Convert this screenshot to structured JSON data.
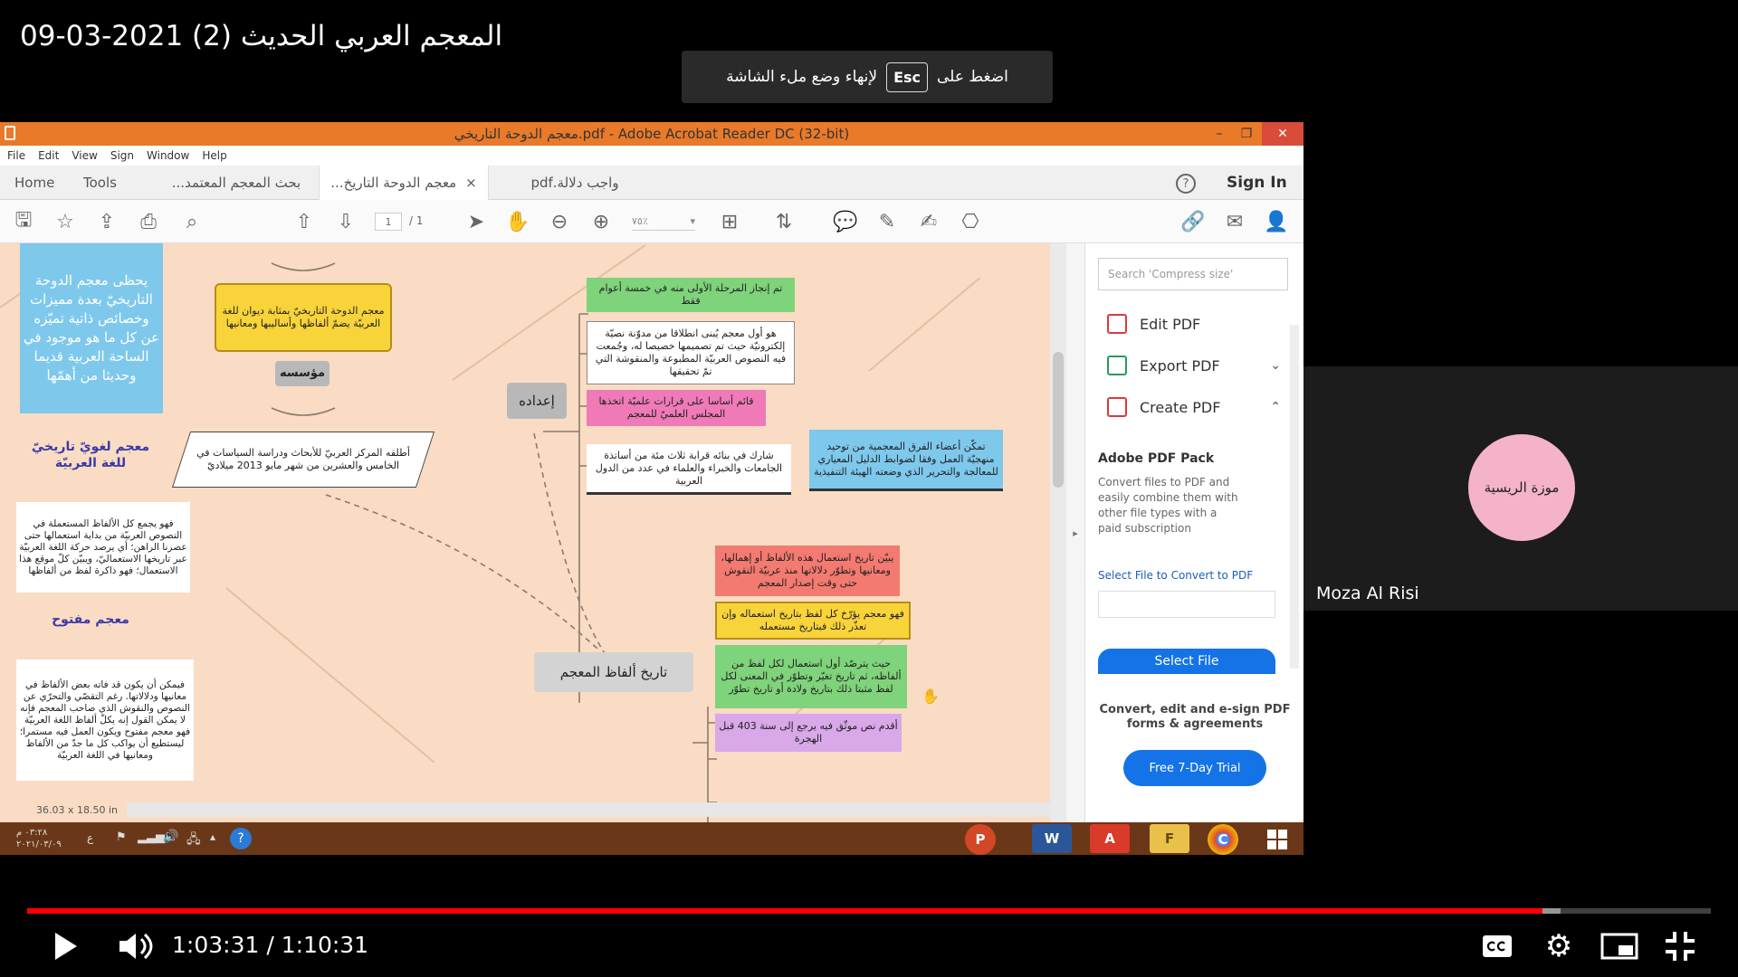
{
  "video": {
    "title": "المعجم العربي الحديث (2) 2021-03-09",
    "esc_hint_before": "اضغط على",
    "esc_key": "Esc",
    "esc_hint_after": "لإنهاء وضع ملء الشاشة",
    "current_time": "1:03:31",
    "duration": "1:10:31",
    "progress_played": 0.9,
    "progress_loaded": 0.911
  },
  "acrobat": {
    "window_title": "معجم الدوحة التاريخي.pdf - Adobe Acrobat Reader DC (32-bit)",
    "menu": [
      "File",
      "Edit",
      "View",
      "Sign",
      "Window",
      "Help"
    ],
    "tabs": {
      "home": "Home",
      "tools": "Tools",
      "tab1": "بحث المعجم المعتمد...",
      "tab2": "معجم الدوحة التاريخ...",
      "tab3": "واجب دلالة.pdf"
    },
    "sign_in": "Sign In",
    "page_current": "1",
    "page_total": "/ 1",
    "zoom": "٧٥٪",
    "doc_size": "36.03 x 18.50 in",
    "accent_color": "#e87a2a"
  },
  "mindmap": {
    "left_blue": "يحظى معجم الدوحة التاريخيّ بعدة مميزات وخصائص ذاتية تميّزه عن كل ما هو موجود في الساحة العربية قديما وحديثا من أهمّها",
    "yellow_top": "معجم الدوحة التاريخيّ بمثابة ديوان للغة العربيّة يضمّ ألفاظها وأساليبها ومعانيها",
    "muassasa": "مؤسسه",
    "centre_desc": "أطلقه المركز العربيّ للأبحاث ودراسة السياسات في الخامس والعشرين من شهر مايو 2013 ميلاديّ",
    "lughawi": "معجم لغويّ تاريخيّ للغة العربيّة",
    "lughawi_desc": "فهو يجمع كل الألفاظ المستعملة في النصوص العربيّة من بداية استعمالها حتى عصرنا الراهن؛ أي يرصد حركة اللغة العربيّة عبر تاريخها الاستعماليّ، ويبيّن كلّ موقع هذا الاستعمال؛ فهو ذاكرة لفظ من ألفاظها",
    "maftouh": "معجم مفتوح",
    "maftouh_desc": "فيمكن أن يكون قد فاته بعض الألفاظ في معانيها ودلالاتها. رغم التقصّي والتحرّي عن النصوص والنقوش الذي صاحب المعجم فإنه لا يمكن القول إنه يكلّ ألفاظ اللغة العربيّة فهو معجم مفتوح ويكون العمل فيه مستمرا؛ ليستطيع أن يواكب كل ما جدّ من الألفاظ ومعانيها في اللغة العربيّة",
    "idad": "إعداده",
    "green1": "تم إنجاز المرحلة الأولى منه في خمسة أعوام فقط",
    "white1": "هو أول معجم يُبنى انطلاقا من مدوّنة نصيّة إلكترونيّة حيث تم تصميمها خصيصا له، وجُمعت فيه النصوص العربيّة المطبوعة والمنقوشة التي تمّ تحقيقها",
    "pink1": "قائم أساسا على قرارات علميّة اتخذها المجلس العلميّ للمعجم",
    "white2": "شارك في بنائه قرابة ثلاث مئة من أساتذة الجامعات والخبراء والعلماء في عدد من الدول العربية",
    "blue2": "تمكّن أعضاء الفرق المعجمية من توحيد منهجيّة العمل وفقا لضوابط الدليل المعياري للمعالجة والتحرير الذي وضعته الهيئة التنفيذية",
    "tarikh": "تاريخ ألفاظ المعجم",
    "red1": "يبيّن تاريخ استعمال هذه الألفاظ أو إهمالها، ومعانيها وتطوّر دلالاتها منذ عربيّة النقوش حتى وقت إصدار المعجم",
    "yellow2": "فهو معجم يؤرّخ كل لفظ بتاريخ استعماله وإن تعذّر ذلك فبتاريخ مستعمله",
    "green2": "حيث يترصّد أول استعمال لكل لفظ من ألفاظه، ثم تاريخ تغيّر وتطوّر في المعنى لكل لفظ مثبتا ذلك بتاريخ ولادة أو تاريخ تطوّر",
    "purple1": "أقدم نص موثّق فيه يرجع إلى سنة 403 قبل الهجرة"
  },
  "right_panel": {
    "search_placeholder": "Search 'Compress size'",
    "edit_pdf": "Edit PDF",
    "export_pdf": "Export PDF",
    "create_pdf": "Create PDF",
    "pack_title": "Adobe PDF Pack",
    "pack_desc": "Convert files to PDF and easily combine them with other file types with a paid subscription",
    "select_file_link": "Select File to Convert to PDF",
    "select_file_button": "Select File",
    "promo": "Convert, edit and e-sign PDF forms & agreements",
    "free_trial": "Free 7-Day Trial"
  },
  "taskbar": {
    "clock_time": "٠٣:٢٨ م",
    "clock_date": "٢٠٢١/٠٣/٠٩",
    "lang": "ع",
    "apps": [
      "P",
      "W",
      "A",
      "F",
      "C"
    ]
  },
  "participant": {
    "avatar_text": "موزة الريسية",
    "name": "Moza Al Risi"
  }
}
